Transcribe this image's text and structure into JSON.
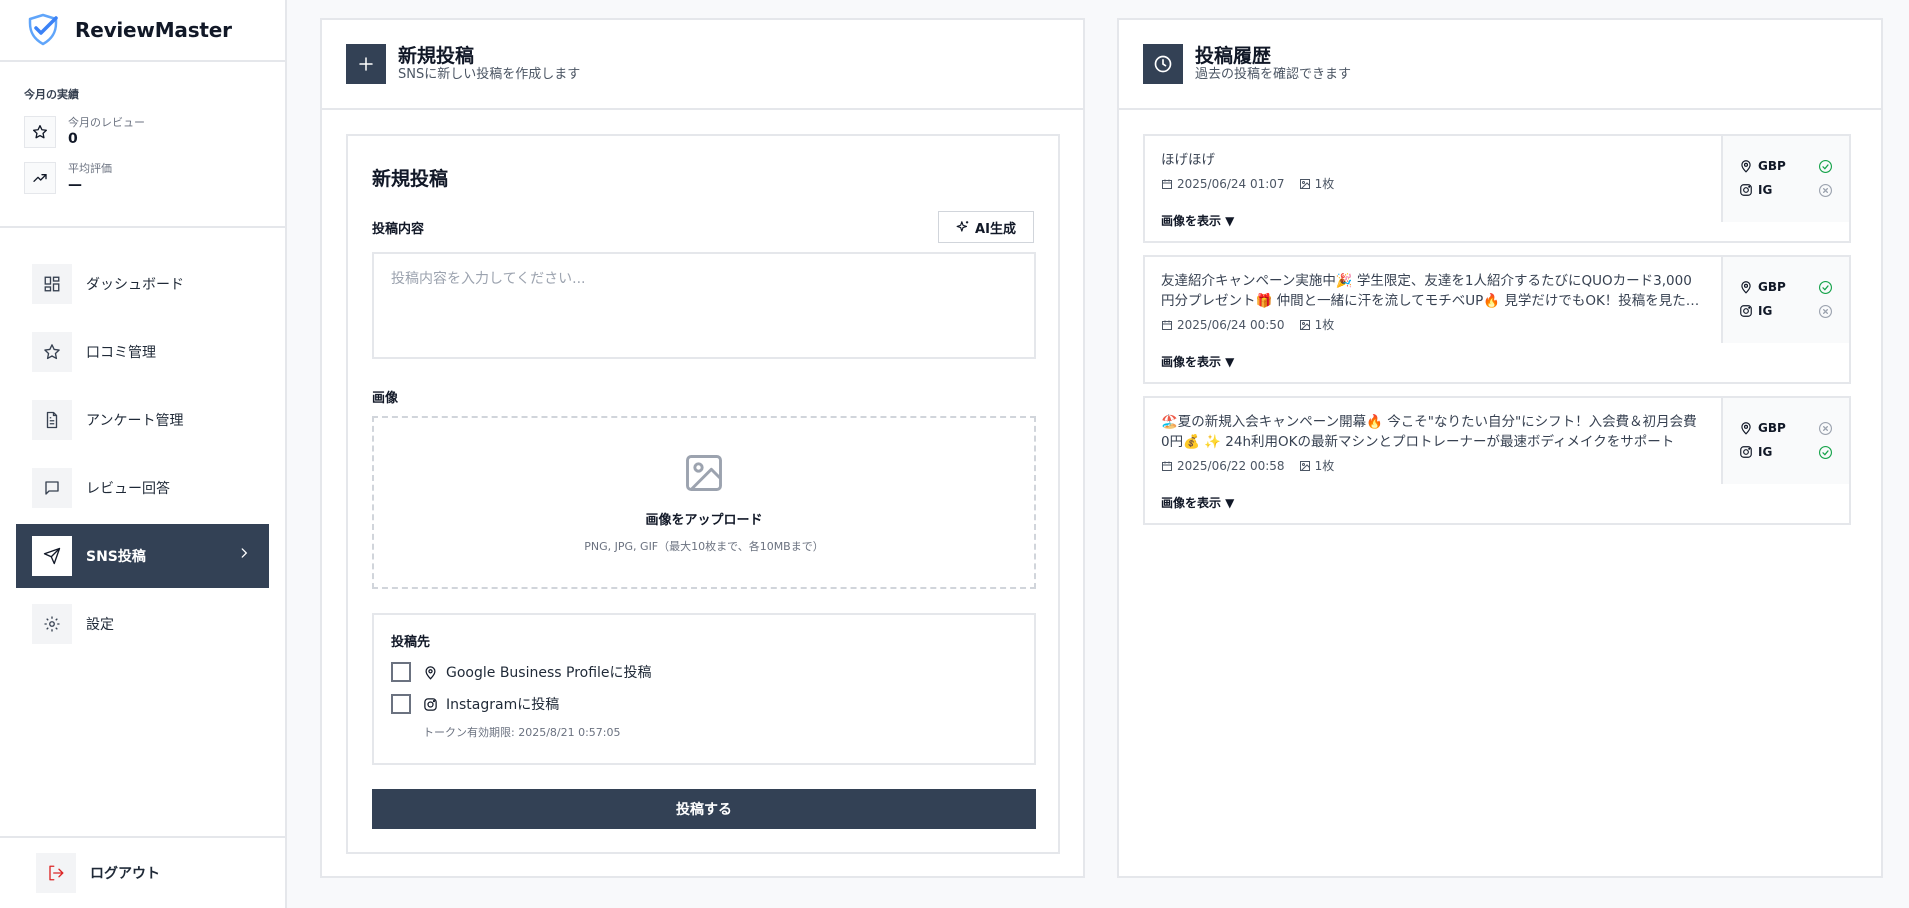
{
  "app": {
    "name": "ReviewMaster"
  },
  "stats": {
    "title": "今月の実績",
    "reviews_label": "今月のレビュー",
    "reviews_value": "0",
    "rating_label": "平均評価",
    "rating_value": "—"
  },
  "nav": {
    "items": [
      {
        "label": "ダッシュボード",
        "icon": "dashboard-icon"
      },
      {
        "label": "口コミ管理",
        "icon": "star-icon"
      },
      {
        "label": "アンケート管理",
        "icon": "document-icon"
      },
      {
        "label": "レビュー回答",
        "icon": "message-icon"
      },
      {
        "label": "SNS投稿",
        "icon": "send-icon",
        "active": true
      },
      {
        "label": "設定",
        "icon": "gear-icon"
      }
    ],
    "logout": "ログアウト"
  },
  "new_post": {
    "header_title": "新規投稿",
    "header_sub": "SNSに新しい投稿を作成します",
    "form_title": "新規投稿",
    "content_label": "投稿内容",
    "ai_button": "AI生成",
    "content_placeholder": "投稿内容を入力してください...",
    "content_value": "",
    "image_label": "画像",
    "upload_title": "画像をアップロード",
    "upload_sub": "PNG, JPG, GIF（最大10枚まで、各10MBまで）",
    "targets_title": "投稿先",
    "target_gbp": "Google Business Profileに投稿",
    "target_gbp_checked": false,
    "target_ig": "Instagramに投稿",
    "target_ig_checked": false,
    "token_expiry": "トークン有効期限: 2025/8/21 0:57:05",
    "submit": "投稿する"
  },
  "history": {
    "header_title": "投稿履歴",
    "header_sub": "過去の投稿を確認できます",
    "show_images": "画像を表示 ▼",
    "posts": [
      {
        "text": "ほげほげ",
        "date": "2025/06/24 01:07",
        "images": "1枚",
        "gbp_label": "GBP",
        "gbp_status": "success",
        "ig_label": "IG",
        "ig_status": "failed"
      },
      {
        "text": "友達紹介キャンペーン実施中🎉 学生限定、友達を1人紹介するたびにQUOカード3,000円分プレゼント🎁 仲間と一緒に汗を流してモチベUP🔥 見学だけでもOK！投稿を見た方は受付でお声がけください",
        "date": "2025/06/24 00:50",
        "images": "1枚",
        "gbp_label": "GBP",
        "gbp_status": "success",
        "ig_label": "IG",
        "ig_status": "failed"
      },
      {
        "text": "🏖️夏の新規入会キャンペーン開幕🔥 今こそ\"なりたい自分\"にシフト！入会費＆初月会費0円💰 ✨ 24h利用OKの最新マシンとプロトレーナーが最速ボディメイクをサポート",
        "date": "2025/06/22 00:58",
        "images": "1枚",
        "gbp_label": "GBP",
        "gbp_status": "failed",
        "ig_label": "IG",
        "ig_status": "success"
      }
    ]
  },
  "colors": {
    "primary": "#334155",
    "success": "#16a34a",
    "failed": "#9ca3af",
    "logout_icon": "#dc2626",
    "brand_icon": "#3b82f6"
  }
}
